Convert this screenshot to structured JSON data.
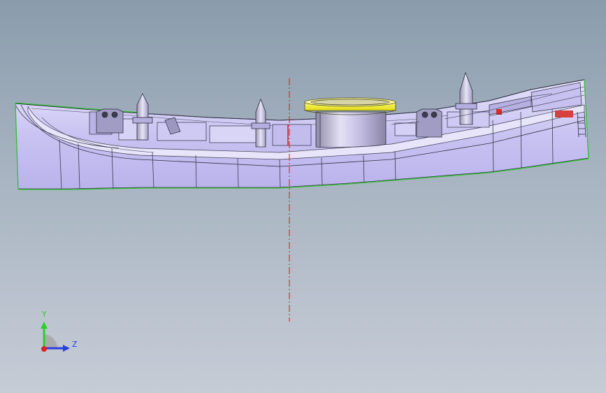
{
  "viewport": {
    "background_top": "#8a9cac",
    "background_bottom": "#c6ccd6"
  },
  "model": {
    "hull_color": "#c9c3f2",
    "edge_color": "#2e2e3e",
    "outline_color": "#35c235",
    "ring_color": "#f2f018",
    "centerline_color": "#cc1e1e"
  },
  "triad": {
    "y_label": "Y",
    "z_label": "Z",
    "y_color": "#2bcf2b",
    "z_color": "#2a3fe0",
    "x_color": "#e02020"
  }
}
